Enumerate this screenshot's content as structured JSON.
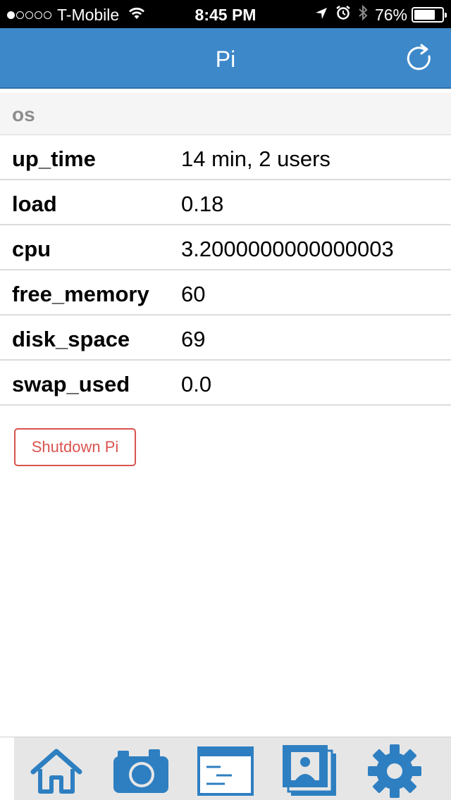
{
  "status_bar": {
    "carrier": "T-Mobile",
    "signal_bars_filled": 1,
    "signal_bars_total": 5,
    "time": "8:45 PM",
    "battery_percent": "76%",
    "battery_level": 0.76,
    "icons": [
      "wifi-icon",
      "location-arrow-icon",
      "alarm-clock-icon",
      "bluetooth-icon",
      "battery-icon"
    ]
  },
  "nav": {
    "title": "Pi",
    "refresh_icon": "refresh-icon"
  },
  "section": {
    "title": "os"
  },
  "rows": [
    {
      "key": "up_time",
      "value": "14 min, 2 users"
    },
    {
      "key": "load",
      "value": "0.18"
    },
    {
      "key": "cpu",
      "value": "3.2000000000000003"
    },
    {
      "key": "free_memory",
      "value": "60"
    },
    {
      "key": "disk_space",
      "value": "69"
    },
    {
      "key": "swap_used",
      "value": "0.0"
    }
  ],
  "shutdown_button": {
    "label": "Shutdown Pi"
  },
  "tab_bar": {
    "icons": [
      "home-icon",
      "camera-icon",
      "console-icon",
      "photo-gallery-icon",
      "settings-gear-icon"
    ]
  },
  "colors": {
    "nav_background": "#3d88c9",
    "tab_icon": "#2e7fc1",
    "danger": "#d9534f",
    "section_text": "#8d8d8d"
  }
}
